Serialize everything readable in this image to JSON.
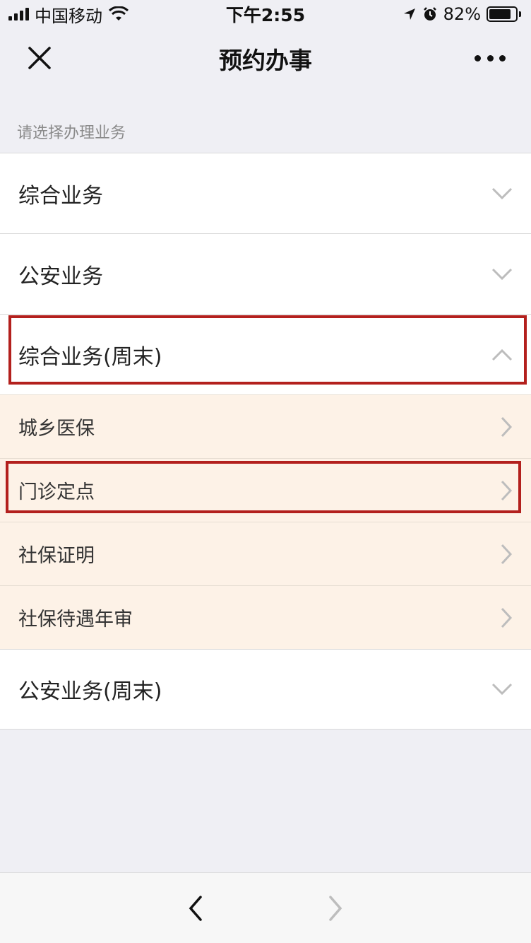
{
  "status_bar": {
    "carrier": "中国移动",
    "time": "下午2:55",
    "battery_percent": "82%",
    "battery_level": 0.82,
    "icons": [
      "signal-icon",
      "wifi-icon",
      "location-icon",
      "alarm-icon",
      "battery-icon"
    ]
  },
  "nav": {
    "title": "预约办事",
    "close_icon": "close-icon",
    "more_icon": "more-icon"
  },
  "hint": "请选择办理业务",
  "groups": [
    {
      "label": "综合业务",
      "expanded": false
    },
    {
      "label": "公安业务",
      "expanded": false
    },
    {
      "label": "综合业务(周末)",
      "expanded": true,
      "items": [
        "城乡医保",
        "门诊定点",
        "社保证明",
        "社保待遇年审"
      ]
    },
    {
      "label": "公安业务(周末)",
      "expanded": false
    }
  ],
  "colors": {
    "highlight": "#b3201d",
    "submenu_bg": "#fdf2e7",
    "page_bg": "#efeff4"
  },
  "bottom_bar": {
    "back_icon": "back-arrow-icon",
    "forward_icon": "forward-arrow-icon"
  }
}
